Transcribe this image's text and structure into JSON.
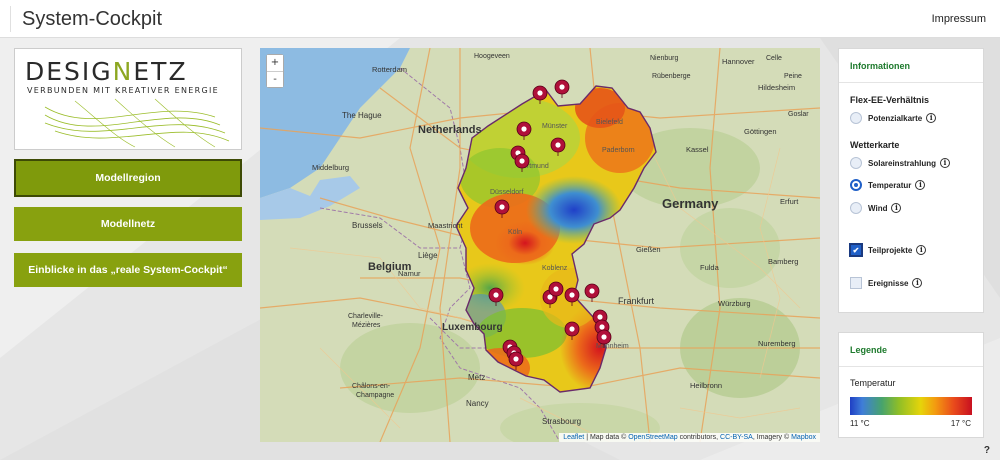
{
  "header": {
    "title": "System-Cockpit",
    "impressum": "Impressum"
  },
  "logo": {
    "wordmark_pre": "DESIG",
    "wordmark_n": "N",
    "wordmark_post": "ETZ",
    "tagline": "VERBUNDEN MIT KREATIVER ENERGIE"
  },
  "nav": {
    "items": [
      {
        "label": "Modellregion",
        "active": true
      },
      {
        "label": "Modellnetz",
        "active": false
      },
      {
        "label": "Einblicke in das „reale System-Cockpit“",
        "active": false
      }
    ]
  },
  "map": {
    "zoom_in": "+",
    "zoom_out": "-",
    "labels": {
      "netherlands": "Netherlands",
      "germany": "Germany",
      "belgium": "Belgium",
      "luxembourg": "Luxembourg",
      "the_hague": "The Hague",
      "middelburg": "Middelburg",
      "brussels": "Brussels",
      "liege": "Liège",
      "maastricht": "Maastricht",
      "namur": "Namur",
      "charleville": "Charleville-\nMézières",
      "chalons": "Châlons-en-\nChampagne",
      "nancy": "Nancy",
      "metz": "Metz",
      "strasbourg": "Strasbourg",
      "frankfurt": "Frankfurt",
      "giessen": "Gießen",
      "kassel": "Kassel",
      "hannover": "Hannover",
      "hildesheim": "Hildesheim",
      "goettingen": "Göttingen",
      "erfurt": "Erfurt",
      "wuerzburg": "Würzburg",
      "fulda": "Fulda",
      "bamberg": "Bamberg",
      "nuremberg": "Nuremberg",
      "heilbronn": "Heilbronn",
      "muenster": "Münster",
      "dortmund": "Dortmund",
      "duesseldorf": "Düsseldorf",
      "koeln": "Köln",
      "koblenz": "Koblenz",
      "bielefeld": "Bielefeld",
      "paderborn": "Paderborn",
      "rotterdam": "Rotterdam",
      "hoogeveen": "Hoogeveen",
      "nienburg": "Nienburg",
      "ruebenberge": "Rübenberge",
      "celle": "Celle",
      "peine": "Peine",
      "goslar": "Goslar",
      "kaiserslautern": "Mannheim"
    },
    "attribution": {
      "leaflet": "Leaflet",
      "text1": " | Map data © ",
      "osm": "OpenStreetMap",
      "text2": " contributors, ",
      "license": "CC-BY-SA",
      "text3": ", Imagery © ",
      "mapbox": "Mapbox"
    },
    "colors": {
      "land": "#cfd9b0",
      "water": "#8db8e0",
      "border": "#7a2a80",
      "marker": "#b0103a"
    }
  },
  "info_panel": {
    "title": "Informationen",
    "flex_title": "Flex-EE-Verhältnis",
    "potenzialkarte": "Potenzialkarte",
    "wetter_title": "Wetterkarte",
    "solar": "Solareinstrahlung",
    "temperatur": "Temperatur",
    "wind": "Wind",
    "teilprojekte": "Teilprojekte",
    "ereignisse": "Ereignisse",
    "selected_weather": "Temperatur",
    "teilprojekte_checked": true,
    "ereignisse_checked": false
  },
  "legend_panel": {
    "title": "Legende",
    "label": "Temperatur",
    "min": "11 °C",
    "max": "17 °C"
  },
  "help": "?"
}
